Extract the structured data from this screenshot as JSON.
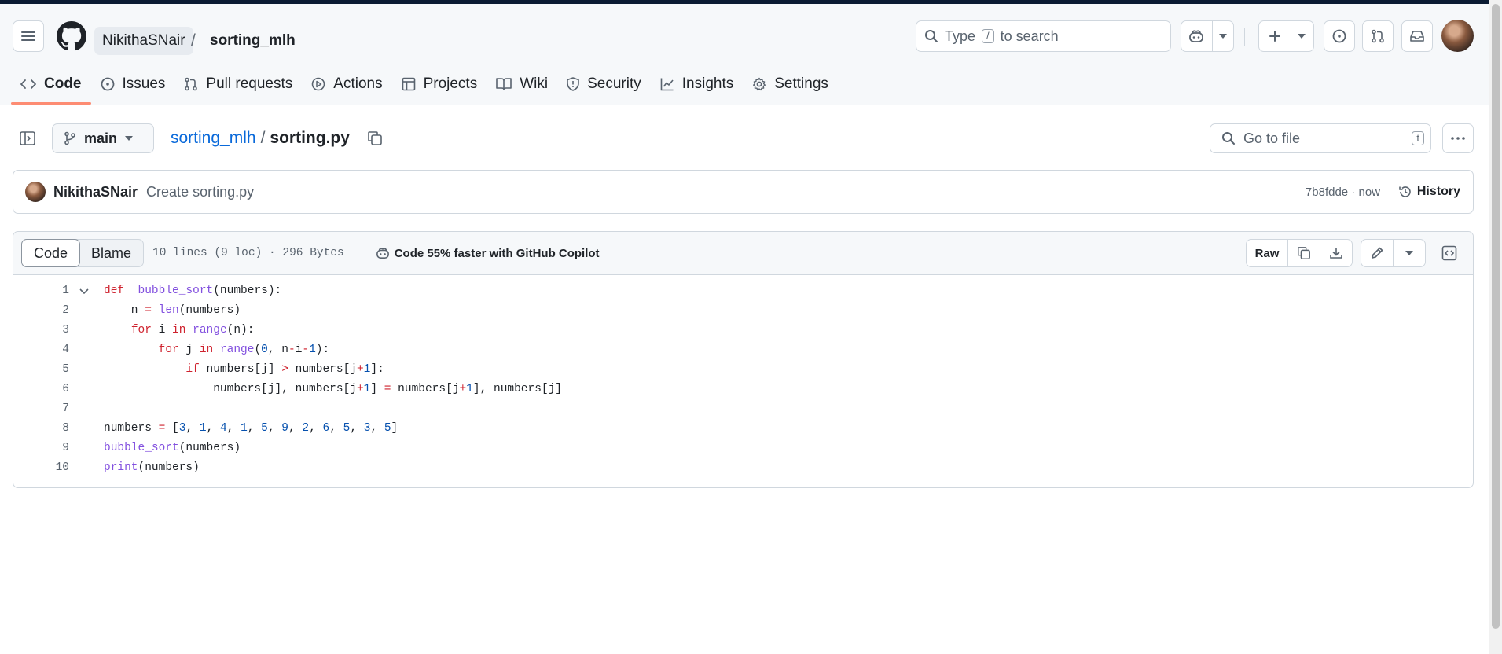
{
  "header": {
    "owner": "NikithaSNair",
    "separator": "/",
    "repo": "sorting_mlh",
    "search": {
      "prefix": "Type",
      "key": "/",
      "suffix": "to search"
    }
  },
  "tabs": [
    {
      "label": "Code",
      "icon": "code-icon",
      "active": true
    },
    {
      "label": "Issues",
      "icon": "issue-icon"
    },
    {
      "label": "Pull requests",
      "icon": "pull-request-icon"
    },
    {
      "label": "Actions",
      "icon": "play-icon"
    },
    {
      "label": "Projects",
      "icon": "table-icon"
    },
    {
      "label": "Wiki",
      "icon": "book-icon"
    },
    {
      "label": "Security",
      "icon": "shield-icon"
    },
    {
      "label": "Insights",
      "icon": "graph-icon"
    },
    {
      "label": "Settings",
      "icon": "gear-icon"
    }
  ],
  "file_nav": {
    "branch": "main",
    "repo_link": "sorting_mlh",
    "separator": "/",
    "file_name": "sorting.py",
    "go_to_file_placeholder": "Go to file",
    "go_to_file_key": "t"
  },
  "commit": {
    "author": "NikithaSNair",
    "message": "Create sorting.py",
    "meta": "7b8fdde · now",
    "history_label": "History"
  },
  "file_header": {
    "code_tab": "Code",
    "blame_tab": "Blame",
    "info": "10 lines (9 loc) · 296 Bytes",
    "copilot": "Code 55% faster with GitHub Copilot",
    "raw": "Raw"
  },
  "code_lines": [
    {
      "num": "1",
      "tokens": [
        [
          "k",
          "def"
        ],
        [
          "",
          "  "
        ],
        [
          "f",
          "bubble_sort"
        ],
        [
          "",
          "(numbers):"
        ]
      ]
    },
    {
      "num": "2",
      "tokens": [
        [
          "",
          "    n "
        ],
        [
          "k",
          "="
        ],
        [
          "",
          ""
        ],
        [
          "f",
          " len"
        ],
        [
          "",
          "(numbers)"
        ]
      ]
    },
    {
      "num": "3",
      "tokens": [
        [
          "",
          "    "
        ],
        [
          "k",
          "for"
        ],
        [
          "",
          " i "
        ],
        [
          "k",
          "in"
        ],
        [
          "f",
          " range"
        ],
        [
          "",
          "(n):"
        ]
      ]
    },
    {
      "num": "4",
      "tokens": [
        [
          "",
          "        "
        ],
        [
          "k",
          "for"
        ],
        [
          "",
          " j "
        ],
        [
          "k",
          "in"
        ],
        [
          "f",
          " range"
        ],
        [
          "",
          "("
        ],
        [
          "n",
          "0"
        ],
        [
          "",
          ", n"
        ],
        [
          "k",
          "-"
        ],
        [
          "",
          "i"
        ],
        [
          "k",
          "-"
        ],
        [
          "n",
          "1"
        ],
        [
          "",
          "):"
        ]
      ]
    },
    {
      "num": "5",
      "tokens": [
        [
          "",
          "            "
        ],
        [
          "k",
          "if"
        ],
        [
          "",
          " numbers[j] "
        ],
        [
          "k",
          ">"
        ],
        [
          "",
          " numbers[j"
        ],
        [
          "k",
          "+"
        ],
        [
          "n",
          "1"
        ],
        [
          "",
          "]:"
        ]
      ]
    },
    {
      "num": "6",
      "tokens": [
        [
          "",
          "                numbers[j], numbers[j"
        ],
        [
          "k",
          "+"
        ],
        [
          "n",
          "1"
        ],
        [
          "",
          "] "
        ],
        [
          "k",
          "="
        ],
        [
          "",
          " numbers[j"
        ],
        [
          "k",
          "+"
        ],
        [
          "n",
          "1"
        ],
        [
          "",
          "], numbers[j]"
        ]
      ]
    },
    {
      "num": "7",
      "tokens": []
    },
    {
      "num": "8",
      "tokens": [
        [
          "",
          "numbers "
        ],
        [
          "k",
          "="
        ],
        [
          "",
          " ["
        ],
        [
          "n",
          "3"
        ],
        [
          "",
          ", "
        ],
        [
          "n",
          "1"
        ],
        [
          "",
          ", "
        ],
        [
          "n",
          "4"
        ],
        [
          "",
          ", "
        ],
        [
          "n",
          "1"
        ],
        [
          "",
          ", "
        ],
        [
          "n",
          "5"
        ],
        [
          "",
          ", "
        ],
        [
          "n",
          "9"
        ],
        [
          "",
          ", "
        ],
        [
          "n",
          "2"
        ],
        [
          "",
          ", "
        ],
        [
          "n",
          "6"
        ],
        [
          "",
          ", "
        ],
        [
          "n",
          "5"
        ],
        [
          "",
          ", "
        ],
        [
          "n",
          "3"
        ],
        [
          "",
          ", "
        ],
        [
          "n",
          "5"
        ],
        [
          "",
          "]"
        ]
      ]
    },
    {
      "num": "9",
      "tokens": [
        [
          "f",
          "bubble_sort"
        ],
        [
          "",
          "(numbers)"
        ]
      ]
    },
    {
      "num": "10",
      "tokens": [
        [
          "f",
          "print"
        ],
        [
          "",
          "(numbers)"
        ]
      ]
    }
  ]
}
